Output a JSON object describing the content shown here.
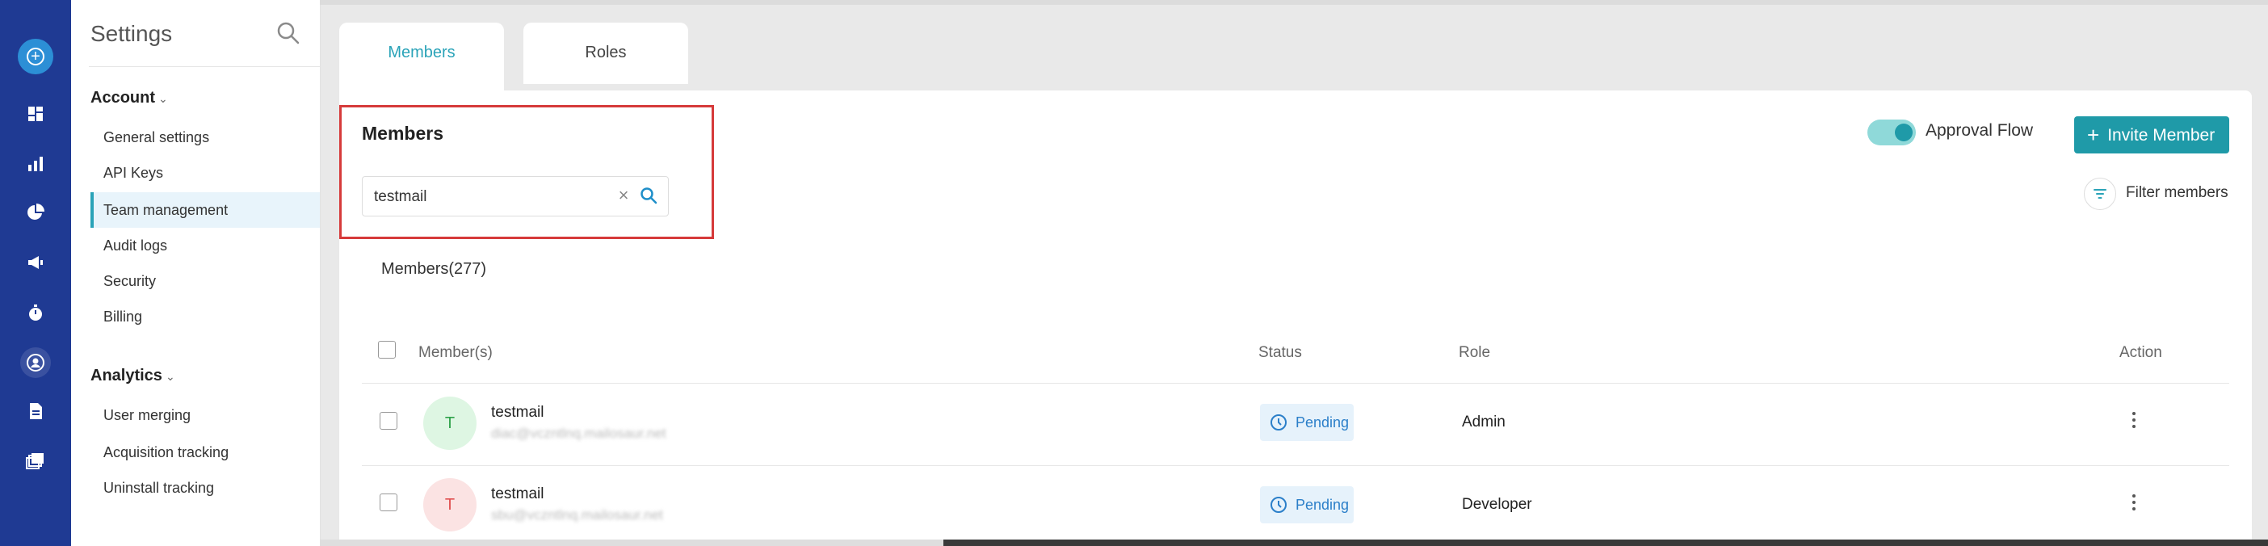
{
  "sidebar": {
    "title": "Settings",
    "sections": [
      {
        "label": "Account",
        "items": [
          "General settings",
          "API Keys",
          "Team management",
          "Audit logs",
          "Security",
          "Billing"
        ]
      },
      {
        "label": "Analytics",
        "items": [
          "User merging",
          "Acquisition tracking",
          "Uninstall tracking"
        ]
      }
    ],
    "active_item": "Team management"
  },
  "tabs": [
    {
      "label": "Members",
      "active": true
    },
    {
      "label": "Roles",
      "active": false
    }
  ],
  "main": {
    "title": "Members",
    "search": {
      "value": "testmail"
    },
    "approval_flow": {
      "label": "Approval Flow",
      "enabled": true
    },
    "invite_button": "Invite Member",
    "filter_label": "Filter members",
    "count_label": "Members(277)"
  },
  "table": {
    "headers": [
      "Member(s)",
      "Status",
      "Role",
      "Action"
    ],
    "rows": [
      {
        "initial": "T",
        "name": "testmail",
        "email": "diac@vczntlnq.mailosaur.net",
        "status": "Pending",
        "role": "Admin"
      },
      {
        "initial": "T",
        "name": "testmail",
        "email": "sbu@vczntlnq.mailosaur.net",
        "status": "Pending",
        "role": "Developer"
      }
    ]
  },
  "colors": {
    "rail": "#1f3a93",
    "accent": "#1f9aa8",
    "highlight": "#d63a3a",
    "pending": "#2b7fc9"
  }
}
